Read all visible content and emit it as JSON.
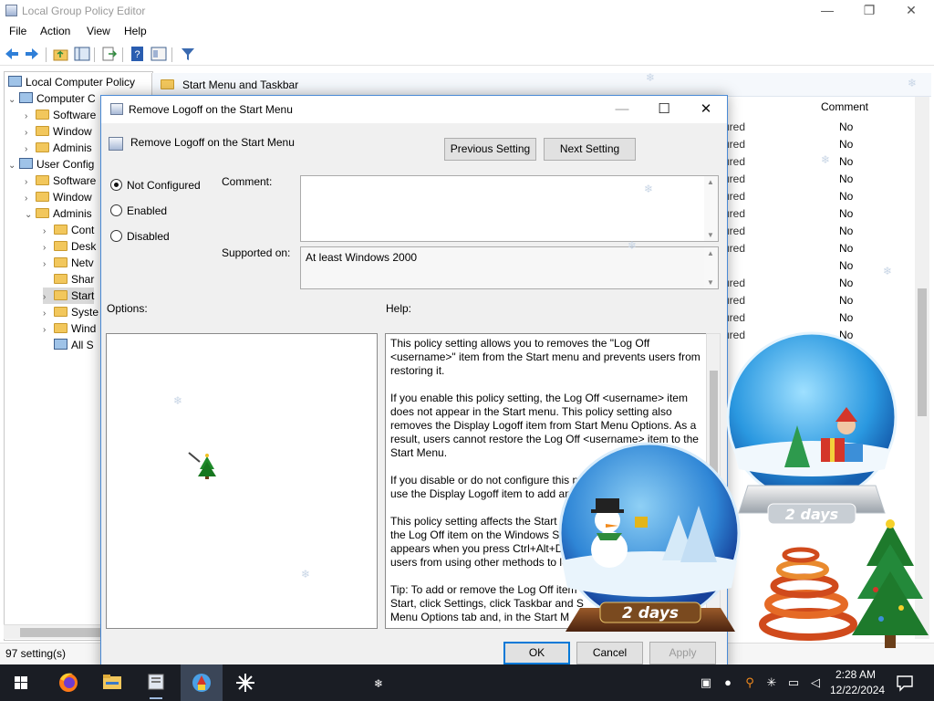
{
  "window": {
    "title": "Local Group Policy Editor",
    "controls": {
      "minimize": "—",
      "maximize": "❐",
      "close": "✕"
    }
  },
  "menu": [
    "File",
    "Action",
    "View",
    "Help"
  ],
  "toolbar_icons": [
    "back-icon",
    "forward-icon",
    "up-folder-icon",
    "show-hide-tree-icon",
    "export-list-icon",
    "help-icon",
    "properties-icon",
    "filter-icon"
  ],
  "tree": {
    "root": "Local Computer Policy",
    "items": [
      {
        "label": "Computer C",
        "depth": 1,
        "arrow": "⌄",
        "icon": "computer-icon"
      },
      {
        "label": "Software",
        "depth": 2,
        "arrow": "›",
        "icon": "folder-icon"
      },
      {
        "label": "Window",
        "depth": 2,
        "arrow": "›",
        "icon": "folder-icon"
      },
      {
        "label": "Adminis",
        "depth": 2,
        "arrow": "›",
        "icon": "folder-icon"
      },
      {
        "label": "User Config",
        "depth": 1,
        "arrow": "⌄",
        "icon": "user-icon"
      },
      {
        "label": "Software",
        "depth": 2,
        "arrow": "›",
        "icon": "folder-icon"
      },
      {
        "label": "Window",
        "depth": 2,
        "arrow": "›",
        "icon": "folder-icon"
      },
      {
        "label": "Adminis",
        "depth": 2,
        "arrow": "⌄",
        "icon": "folder-icon"
      },
      {
        "label": "Cont",
        "depth": 3,
        "arrow": "›",
        "icon": "folder-icon"
      },
      {
        "label": "Desk",
        "depth": 3,
        "arrow": "›",
        "icon": "folder-icon"
      },
      {
        "label": "Netv",
        "depth": 3,
        "arrow": "›",
        "icon": "folder-icon"
      },
      {
        "label": "Shar",
        "depth": 3,
        "arrow": "",
        "icon": "folder-icon"
      },
      {
        "label": "Start",
        "depth": 3,
        "arrow": "›",
        "icon": "folder-icon",
        "selected": true
      },
      {
        "label": "Syste",
        "depth": 3,
        "arrow": "›",
        "icon": "folder-icon"
      },
      {
        "label": "Wind",
        "depth": 3,
        "arrow": "›",
        "icon": "folder-icon"
      },
      {
        "label": "All S",
        "depth": 3,
        "arrow": "",
        "icon": "settings-list-icon"
      }
    ]
  },
  "list": {
    "folder_title": "Start Menu and Taskbar",
    "comment_header": "Comment",
    "state_fragment": "ured",
    "rows": [
      {
        "state": "ured",
        "comment": "No"
      },
      {
        "state": "ured",
        "comment": "No"
      },
      {
        "state": "ured",
        "comment": "No"
      },
      {
        "state": "ured",
        "comment": "No"
      },
      {
        "state": "ured",
        "comment": "No"
      },
      {
        "state": "ured",
        "comment": "No"
      },
      {
        "state": "ured",
        "comment": "No"
      },
      {
        "state": "ured",
        "comment": "No"
      },
      {
        "state": "",
        "comment": "No"
      },
      {
        "state": "ured",
        "comment": "No"
      },
      {
        "state": "ured",
        "comment": "No"
      },
      {
        "state": "ured",
        "comment": "No"
      },
      {
        "state": "ured",
        "comment": "No"
      }
    ]
  },
  "status": "97 setting(s)",
  "dialog": {
    "title": "Remove Logoff on the Start Menu",
    "policy_name": "Remove Logoff on the Start Menu",
    "prev_button": "Previous Setting",
    "next_button": "Next Setting",
    "radios": [
      {
        "label": "Not Configured",
        "checked": true
      },
      {
        "label": "Enabled",
        "checked": false
      },
      {
        "label": "Disabled",
        "checked": false
      }
    ],
    "comment_label": "Comment:",
    "comment_value": "",
    "supported_label": "Supported on:",
    "supported_value": "At least Windows 2000",
    "options_label": "Options:",
    "help_label": "Help:",
    "help_text": "This policy setting allows you to removes the \"Log Off <username>\" item from the Start menu and prevents users from restoring it.\n\nIf you enable this policy setting, the Log Off <username> item does not appear in the Start menu. This policy setting also removes the Display Logoff item from Start Menu Options. As a result, users cannot restore the Log Off <username> item to the Start Menu.\n\nIf you disable or do not configure this p\nuse the Display Logoff item to add and\n\nThis policy setting affects the Start m\nthe Log Off item on the Windows Se\nappears when you press Ctrl+Alt+De\nusers from using other methods to lo\n\nTip: To add or remove the Log Off item\nStart, click Settings, click Taskbar and S\nMenu Options tab and, in the Start M",
    "ok_button": "OK",
    "cancel_button": "Cancel",
    "apply_button": "Apply"
  },
  "globes": {
    "left_caption": "2 days",
    "right_caption": "2 days"
  },
  "taskbar": {
    "apps": [
      "windows-start-icon",
      "firefox-icon",
      "file-explorer-icon",
      "group-policy-icon",
      "snow-app-icon",
      "snowflake-app-icon"
    ],
    "time": "2:28 AM",
    "date": "12/22/2024"
  },
  "colors": {
    "accent": "#0078d7",
    "taskbar": "#1a1d24",
    "dialog_bg": "#f0f0f0",
    "folder": "#f2c75c"
  }
}
